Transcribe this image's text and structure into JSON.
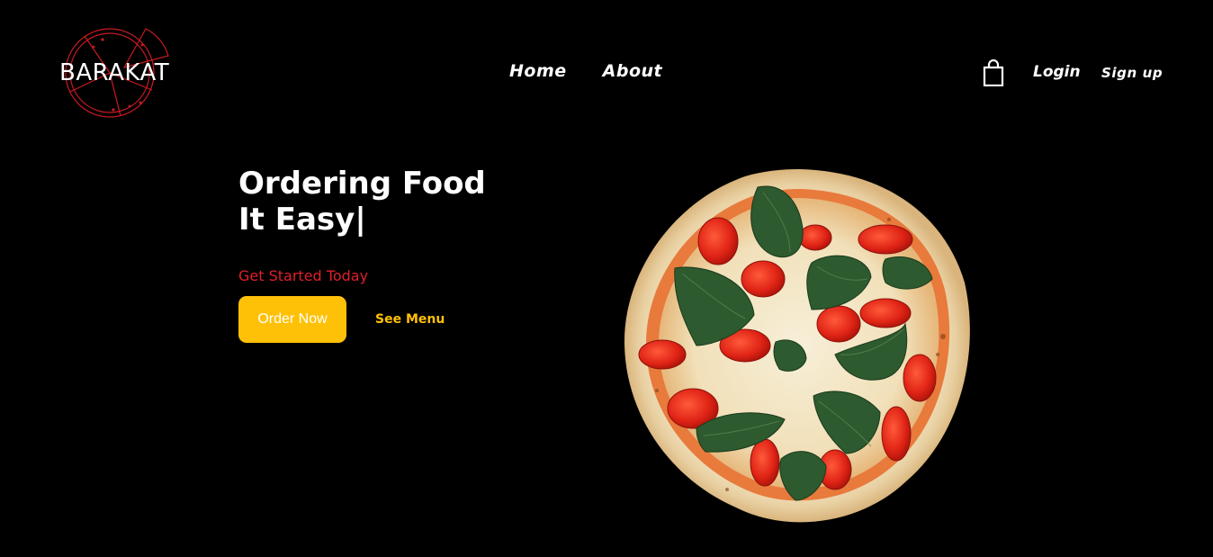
{
  "brand": {
    "name": "BARAKAT",
    "accent": "#e0202a"
  },
  "nav": {
    "home": "Home",
    "about": "About"
  },
  "account": {
    "cart_icon": "shopping-bag-icon",
    "login": "Login",
    "signup": "Sign up"
  },
  "hero": {
    "title_line1": "Ordering Food",
    "title_line2": "It Easy",
    "cursor": "|",
    "tagline": "Get Started Today",
    "order_button": "Order Now",
    "menu_link": "See Menu",
    "button_color": "#ffc107"
  },
  "image": {
    "subject": "pizza-margherita-image"
  }
}
